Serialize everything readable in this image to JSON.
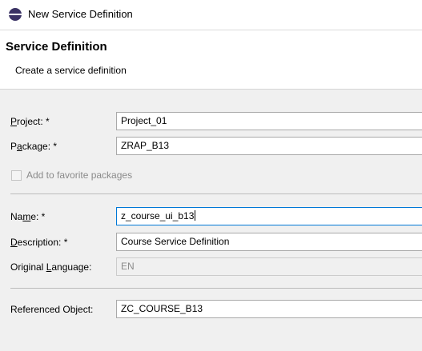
{
  "window": {
    "title": "New Service Definition"
  },
  "header": {
    "title": "Service Definition",
    "description": "Create a service definition"
  },
  "form": {
    "project": {
      "label_pre": "",
      "label_mn": "P",
      "label_post": "roject: *",
      "value": "Project_01"
    },
    "package": {
      "label_pre": "P",
      "label_mn": "a",
      "label_post": "ckage: *",
      "value": "ZRAP_B13"
    },
    "favorite": {
      "label": "Add to favorite packages",
      "checked": false
    },
    "name": {
      "label_pre": "Na",
      "label_mn": "m",
      "label_post": "e: *",
      "value": "z_course_ui_b13"
    },
    "description": {
      "label_pre": "",
      "label_mn": "D",
      "label_post": "escription: *",
      "value": "Course Service Definition"
    },
    "language": {
      "label_pre": "Original ",
      "label_mn": "L",
      "label_post": "anguage:",
      "value": "EN"
    },
    "referenced": {
      "label": "Referenced Object:",
      "value": "ZC_COURSE_B13"
    }
  }
}
